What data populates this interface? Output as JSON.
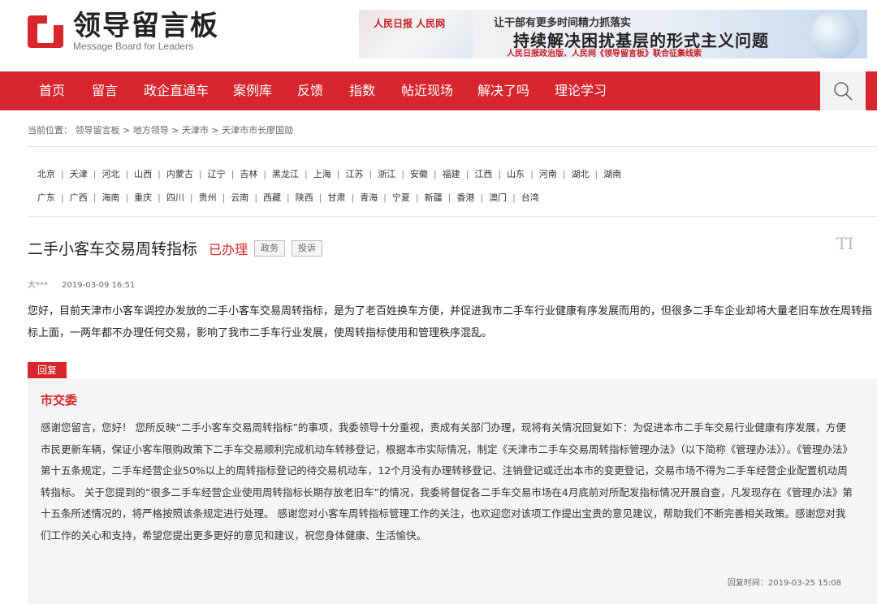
{
  "header": {
    "logo_title": "领导留言板",
    "logo_subtitle": "Message Board for Leaders",
    "banner": {
      "brand": "人民日报 人民网",
      "line1": "让干部有更多时间精力抓落实",
      "line2": "持续解决困扰基层的形式主义问题",
      "line3": "人民日报政治版、人民网《领导留言板》联合征集线索"
    }
  },
  "nav": {
    "items": [
      "首页",
      "留言",
      "政企直通车",
      "案例库",
      "反馈",
      "指数",
      "帖近现场",
      "解决了吗",
      "理论学习"
    ],
    "search_icon": "search-icon"
  },
  "breadcrumb": {
    "text": "当前位置： 领导留言板 > 地方领导 > 天津市 > 天津市市长廖国勋"
  },
  "regions": {
    "row1": [
      "北京",
      "天津",
      "河北",
      "山西",
      "内蒙古",
      "辽宁",
      "吉林",
      "黑龙江",
      "上海",
      "江苏",
      "浙江",
      "安徽",
      "福建",
      "江西",
      "山东",
      "河南",
      "湖北",
      "湖南"
    ],
    "row2": [
      "广东",
      "广西",
      "海南",
      "重庆",
      "四川",
      "贵州",
      "云南",
      "西藏",
      "陕西",
      "甘肃",
      "青海",
      "宁夏",
      "新疆",
      "香港",
      "澳门",
      "台湾"
    ]
  },
  "message": {
    "title": "二手小客车交易周转指标",
    "status": "已办理",
    "tags": [
      "政务",
      "投诉"
    ],
    "font_toggle": "TI",
    "author": "大***",
    "date": "2019-03-09 16:51",
    "content": "您好，目前天津市小客车调控办发放的二手小客车交易周转指标，是为了老百姓换车方便，并促进我市二手车行业健康有序发展而用的，但很多二手车企业却将大量老旧车放在周转指标上面，一两年都不办理任何交易，影响了我市二手车行业发展，使周转指标使用和管理秩序混乱。"
  },
  "reply": {
    "label": "回复",
    "org": "市交委",
    "content": "感谢您留言，您好！ 您所反映“二手小客车交易周转指标”的事项，我委领导十分重视，责成有关部门办理，现将有关情况回复如下：为促进本市二手车交易行业健康有序发展，方便市民更新车辆，保证小客车限购政策下二手车交易顺利完成机动车转移登记，根据本市实际情况，制定《天津市二手车交易周转指标管理办法》（以下简称《管理办法》）。《管理办法》第十五条规定，二手车经营企业50%以上的周转指标登记的待交易机动车，12个月没有办理转移登记、注销登记或迁出本市的变更登记，交易市场不得为二手车经营企业配置机动周转指标。 关于您提到的“很多二手车经营企业使用周转指标长期存放老旧车”的情况，我委将督促各二手车交易市场在4月底前对所配发指标情况开展自查，凡发现存在《管理办法》第十五条所述情况的，将严格按照该条规定进行处理。 感谢您对小客车周转指标管理工作的关注，也欢迎您对该项工作提出宝贵的意见建议，帮助我们不断完善相关政策。感谢您对我们工作的关心和支持，希望您提出更多更好的意见和建议，祝您身体健康、生活愉快。",
    "time": "回复时间：2019-03-25 15:08"
  },
  "colors": {
    "brand_red": "#d7262e",
    "reply_bg": "#f5f5f8"
  }
}
